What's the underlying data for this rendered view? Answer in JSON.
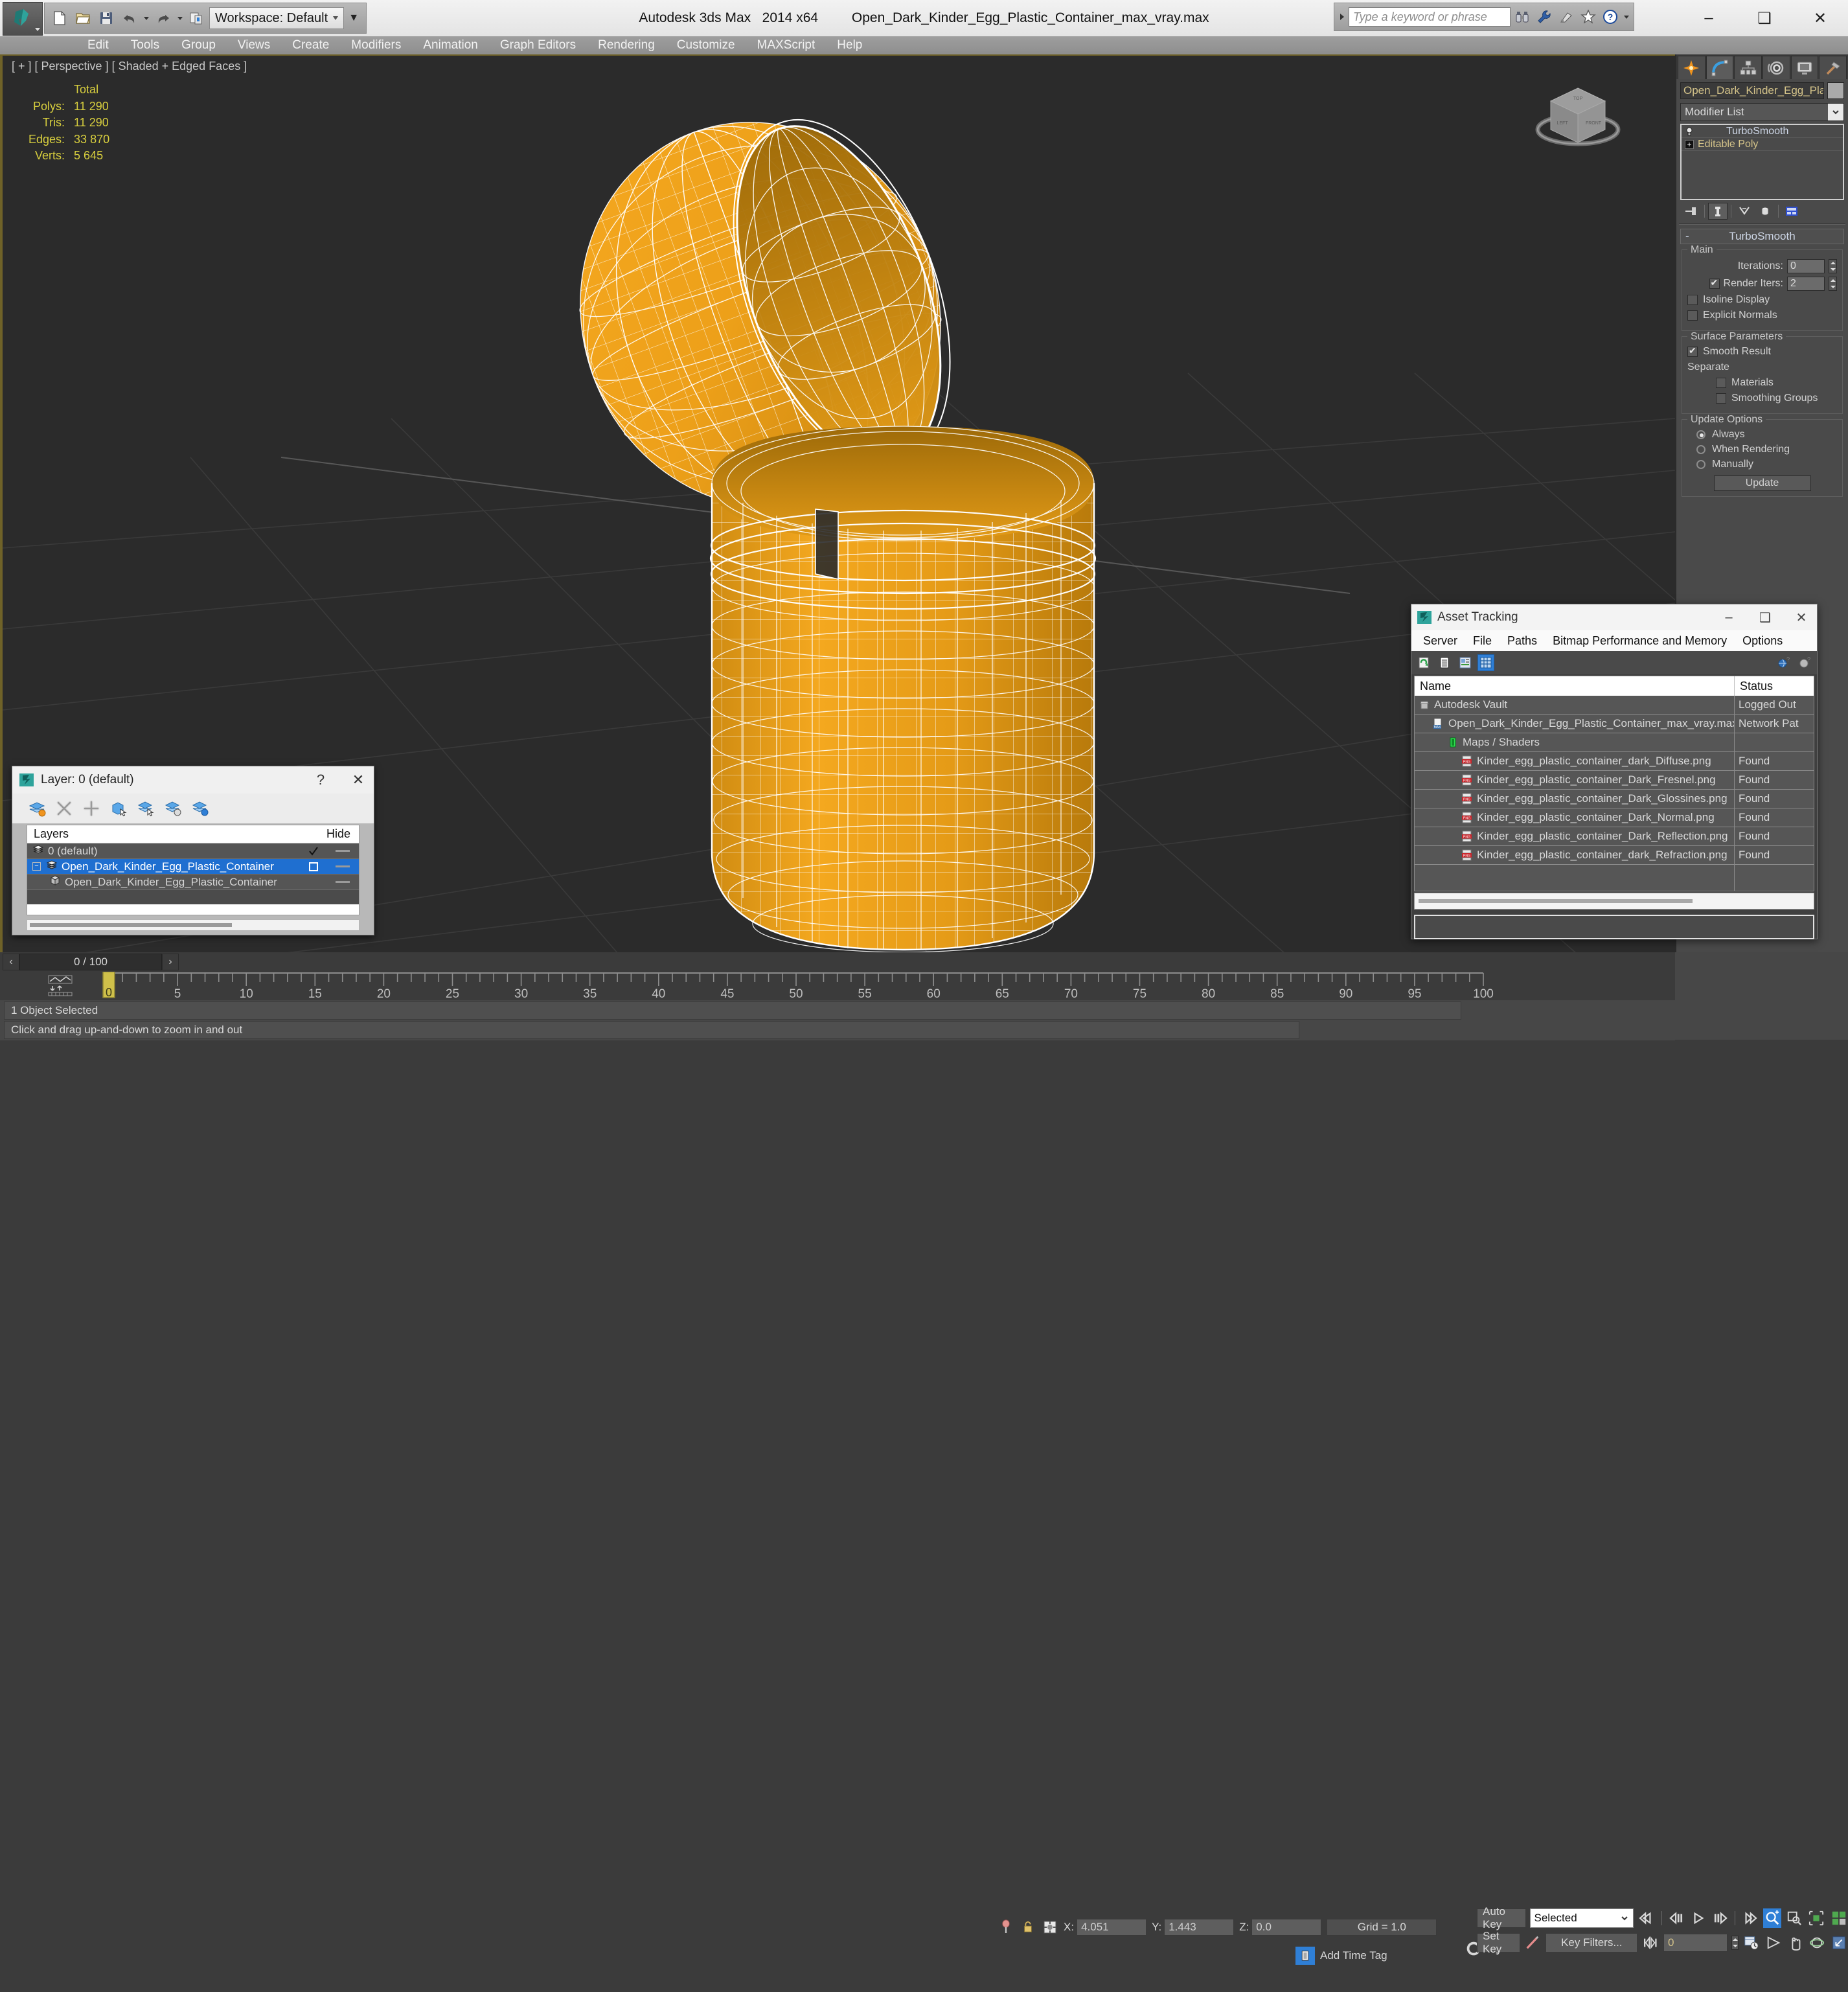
{
  "app": {
    "name": "Autodesk 3ds Max",
    "version": "2014 x64",
    "filename": "Open_Dark_Kinder_Egg_Plastic_Container_max_vray.max",
    "workspace": "Workspace: Default"
  },
  "quick_access": [
    {
      "name": "new-file",
      "tooltip": "New"
    },
    {
      "name": "open-file",
      "tooltip": "Open"
    },
    {
      "name": "save-file",
      "tooltip": "Save"
    },
    {
      "name": "undo",
      "tooltip": "Undo"
    },
    {
      "name": "redo",
      "tooltip": "Redo"
    },
    {
      "name": "set-project-folder",
      "tooltip": "Set Project Folder"
    }
  ],
  "search": {
    "placeholder": "Type a keyword or phrase",
    "icons": [
      "binoculars-icon",
      "wrench-icon",
      "satellite-icon",
      "star-icon",
      "help-icon"
    ]
  },
  "window_buttons": {
    "minimize": "–",
    "maximize": "❑",
    "close": "✕"
  },
  "menu": [
    "Edit",
    "Tools",
    "Group",
    "Views",
    "Create",
    "Modifiers",
    "Animation",
    "Graph Editors",
    "Rendering",
    "Customize",
    "MAXScript",
    "Help"
  ],
  "viewport": {
    "label": "[ + ] [ Perspective ] [ Shaded + Edged Faces ]",
    "stats_header": "Total",
    "stats": [
      {
        "label": "Polys:",
        "value": "11 290"
      },
      {
        "label": "Tris:",
        "value": "11 290"
      },
      {
        "label": "Edges:",
        "value": "33 870"
      },
      {
        "label": "Verts:",
        "value": "5 645"
      }
    ],
    "stats_color": "#d8cf3e",
    "background": "#2b2b2b",
    "model_color": "#f0a01e",
    "wireframe_color": "#ffffff"
  },
  "command_panel": {
    "tabs": [
      {
        "name": "create-tab",
        "icon": "star-burst-icon"
      },
      {
        "name": "modify-tab",
        "icon": "bent-arc-icon"
      },
      {
        "name": "hierarchy-tab",
        "icon": "hierarchy-icon"
      },
      {
        "name": "motion-tab",
        "icon": "motion-wheel-icon"
      },
      {
        "name": "display-tab",
        "icon": "monitor-icon"
      },
      {
        "name": "utilities-tab",
        "icon": "hammer-icon"
      }
    ],
    "active_tab_index": 1,
    "object_name": "Open_Dark_Kinder_Egg_Plas",
    "modifier_list_label": "Modifier List",
    "modifier_stack": [
      {
        "label": "TurboSmooth",
        "selected": true,
        "icon": "lightbulb-icon"
      },
      {
        "label": "Editable Poly",
        "selected": false,
        "icon": "plus-box-icon"
      }
    ],
    "rollout": {
      "title": "TurboSmooth",
      "collapse_symbol": "-",
      "main": {
        "title": "Main",
        "iterations_label": "Iterations:",
        "iterations_value": "0",
        "render_iters_label": "Render Iters:",
        "render_iters_value": "2",
        "render_iters_checked": true,
        "isoline_display_label": "Isoline Display",
        "isoline_display_checked": false,
        "explicit_normals_label": "Explicit Normals",
        "explicit_normals_checked": false
      },
      "surface": {
        "title": "Surface Parameters",
        "smooth_result_label": "Smooth Result",
        "smooth_result_checked": true,
        "separate_label": "Separate",
        "materials_label": "Materials",
        "materials_checked": false,
        "smoothing_groups_label": "Smoothing Groups",
        "smoothing_groups_checked": false
      },
      "update": {
        "title": "Update Options",
        "options": [
          "Always",
          "When Rendering",
          "Manually"
        ],
        "selected_index": 0,
        "button_label": "Update"
      }
    }
  },
  "layer_dialog": {
    "title": "Layer: 0 (default)",
    "help_label": "?",
    "close_label": "✕",
    "toolbar": [
      {
        "name": "new-layer-icon"
      },
      {
        "name": "delete-layer-icon"
      },
      {
        "name": "add-layer-icon"
      },
      {
        "name": "select-object-layer-icon"
      },
      {
        "name": "select-highlighted-layer-icon"
      },
      {
        "name": "highlight-selected-objects-layer-icon"
      },
      {
        "name": "layer-properties-icon"
      }
    ],
    "columns": [
      "Layers",
      "",
      "Hide"
    ],
    "rows": [
      {
        "name": "0 (default)",
        "indent": 0,
        "current": true,
        "selected": false,
        "expandable": false,
        "icon": "layer-stack-icon"
      },
      {
        "name": "Open_Dark_Kinder_Egg_Plastic_Container",
        "indent": 0,
        "current": false,
        "selected": true,
        "expandable": true,
        "expand_symbol": "−",
        "icon": "layer-stack-icon"
      },
      {
        "name": "Open_Dark_Kinder_Egg_Plastic_Container",
        "indent": 1,
        "current": false,
        "selected": false,
        "expandable": false,
        "icon": "box-object-icon"
      }
    ]
  },
  "asset_tracking": {
    "title": "Asset Tracking",
    "window_buttons": {
      "minimize": "–",
      "maximize": "❑",
      "close": "✕"
    },
    "menu": [
      "Server",
      "File",
      "Paths",
      "Bitmap Performance and Memory",
      "Options"
    ],
    "toolbar": [
      {
        "name": "refresh-icon",
        "active": false
      },
      {
        "name": "list-view-icon",
        "active": false
      },
      {
        "name": "detail-view-icon",
        "active": false
      },
      {
        "name": "grid-view-icon",
        "active": true
      }
    ],
    "toolbar_right": [
      {
        "name": "help-globe-icon"
      },
      {
        "name": "help-question-icon"
      }
    ],
    "columns": [
      "Name",
      "Status"
    ],
    "rows": [
      {
        "name": "Autodesk Vault",
        "status": "Logged Out",
        "indent": 0,
        "icon": "vault-icon"
      },
      {
        "name": "Open_Dark_Kinder_Egg_Plastic_Container_max_vray.max",
        "status": "Network Pat",
        "indent": 1,
        "icon": "max-file-icon"
      },
      {
        "name": "Maps / Shaders",
        "status": "",
        "indent": 2,
        "icon": "maps-shaders-icon"
      },
      {
        "name": "Kinder_egg_plastic_container_dark_Diffuse.png",
        "status": "Found",
        "indent": 3,
        "icon": "png-file-icon"
      },
      {
        "name": "Kinder_egg_plastic_container_Dark_Fresnel.png",
        "status": "Found",
        "indent": 3,
        "icon": "png-file-icon"
      },
      {
        "name": "Kinder_egg_plastic_container_Dark_Glossines.png",
        "status": "Found",
        "indent": 3,
        "icon": "png-file-icon"
      },
      {
        "name": "Kinder_egg_plastic_container_Dark_Normal.png",
        "status": "Found",
        "indent": 3,
        "icon": "png-file-icon"
      },
      {
        "name": "Kinder_egg_plastic_container_Dark_Reflection.png",
        "status": "Found",
        "indent": 3,
        "icon": "png-file-icon"
      },
      {
        "name": "Kinder_egg_plastic_container_dark_Refraction.png",
        "status": "Found",
        "indent": 3,
        "icon": "png-file-icon"
      }
    ]
  },
  "timeline": {
    "current_frame": "0 / 100",
    "prev_label": "‹",
    "next_label": "›",
    "ticks": [
      "0",
      "5",
      "10",
      "15",
      "20",
      "25",
      "30",
      "35",
      "40",
      "45",
      "50",
      "55",
      "60",
      "65",
      "70",
      "75",
      "80",
      "85",
      "90",
      "95",
      "100"
    ],
    "slider_position": 0
  },
  "status_bar": {
    "selection": "1 Object Selected",
    "prompt": "Click and drag up-and-down to zoom in and out"
  },
  "coords": {
    "x_label": "X:",
    "x_value": "4.051",
    "y_label": "Y:",
    "y_value": "1.443",
    "z_label": "Z:",
    "z_value": "0.0",
    "grid": "Grid = 1.0",
    "add_time_tag": "Add Time Tag",
    "icons": [
      "pin-icon",
      "lock-icon",
      "absolute-relative-icon"
    ]
  },
  "anim_controls": {
    "auto_key": "Auto Key",
    "set_key": "Set Key",
    "key_mode_value": "Selected",
    "key_filters": "Key Filters...",
    "frame_field": "0",
    "playback_icons": [
      "go-to-start-icon",
      "previous-frame-icon",
      "play-icon",
      "next-frame-icon",
      "go-to-end-icon"
    ],
    "viewport_nav_icons": [
      "zoom-icon",
      "zoom-region-icon",
      "zoom-extents-icon",
      "zoom-extents-all-icon",
      "field-of-view-icon",
      "walkthrough-icon",
      "pan-icon",
      "orbit-icon",
      "maximize-viewport-icon"
    ],
    "key_mode_toggle": "key-mode-toggle-icon"
  }
}
